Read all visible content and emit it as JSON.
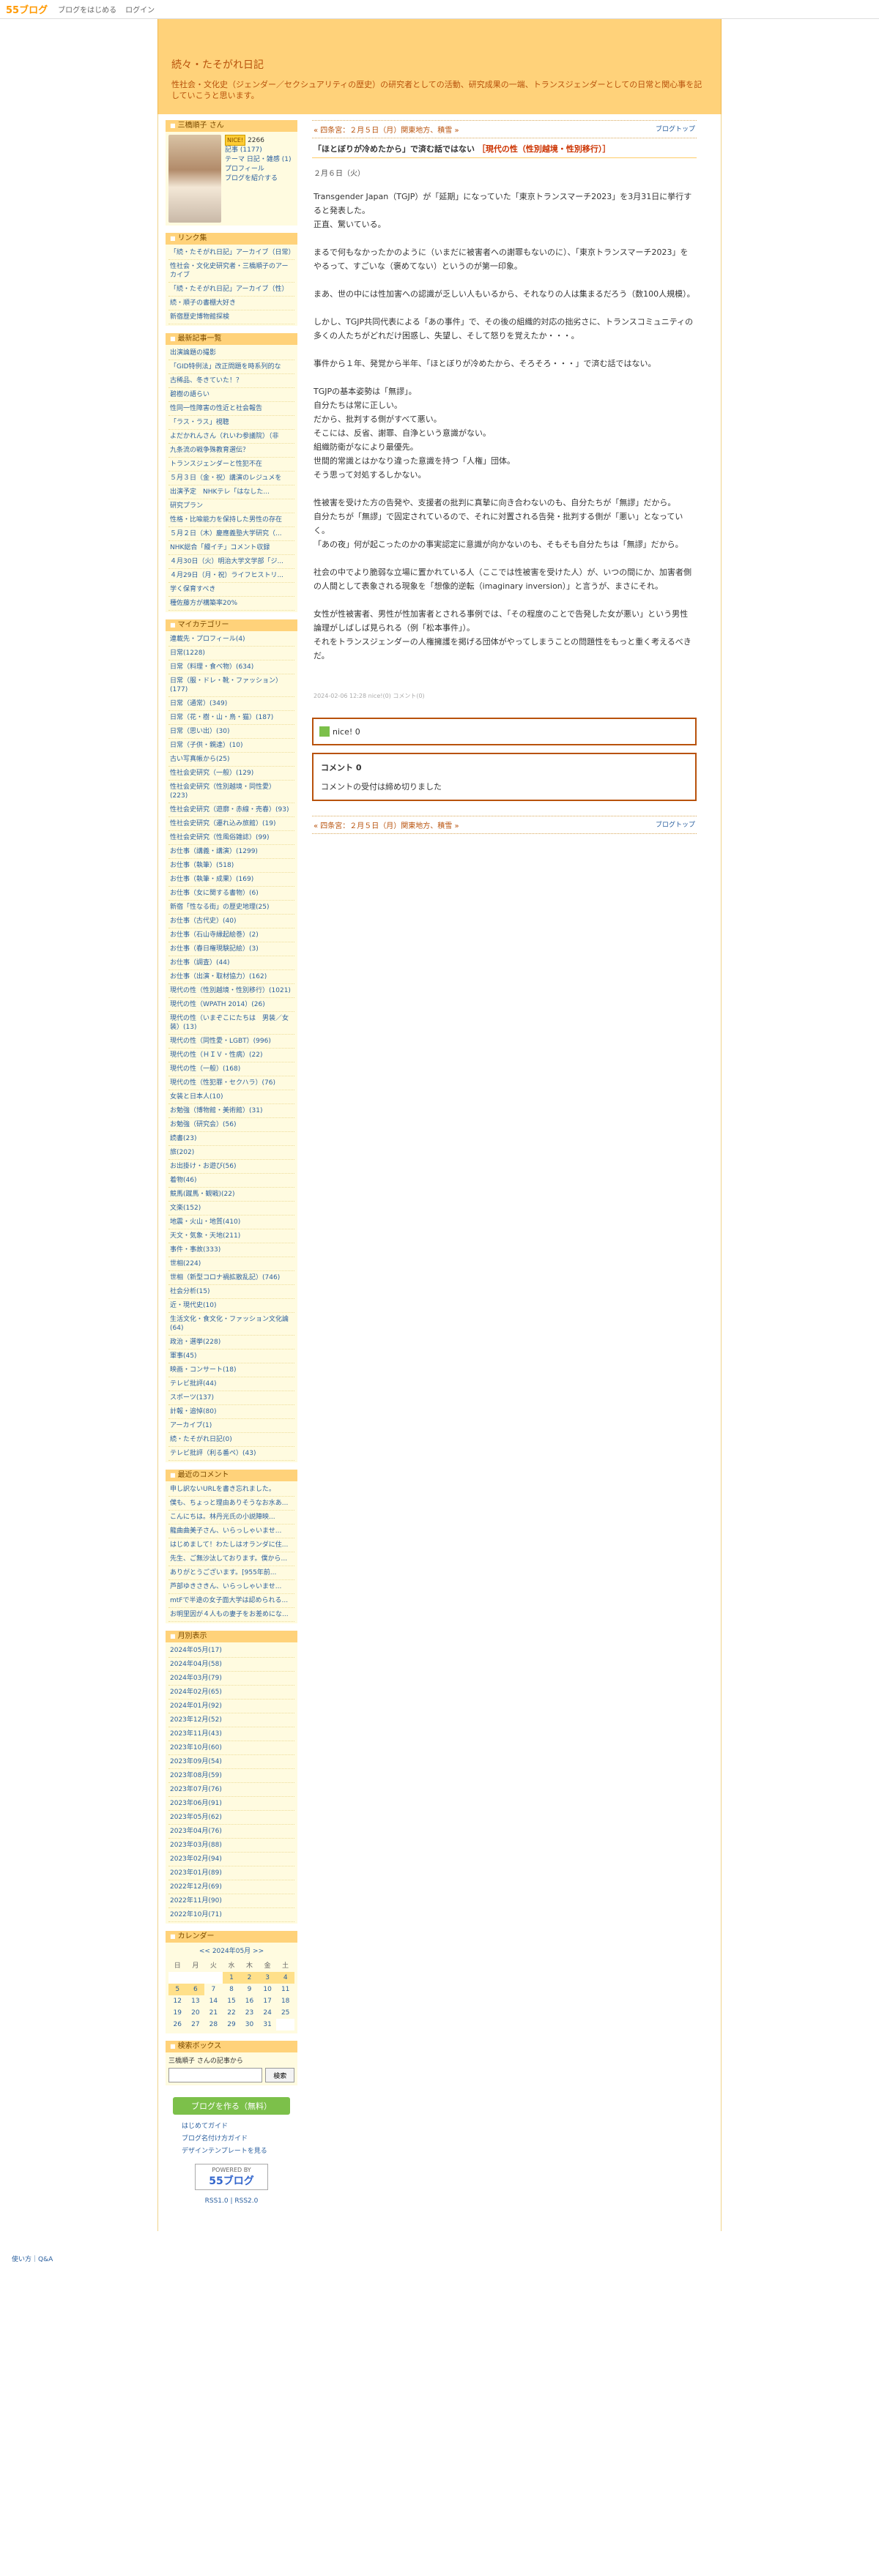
{
  "topbar": {
    "logo": "55ブログ",
    "links": [
      "ブログをはじめる",
      "ログイン"
    ]
  },
  "header": {
    "title": "続々・たそがれ日記",
    "description": "性社会・文化史（ジェンダー／セクシュアリティの歴史）の研究者としての活動、研究成果の一端、トランスジェンダーとしての日常と関心事を記していこうと思います。"
  },
  "profile": {
    "heading": "三橋順子 さん",
    "badge": "NICE!",
    "nice_count": "2266",
    "kiji": "記事 (1177)",
    "theme": "テーマ 日記・雑感 (1)",
    "links": [
      "プロフィール",
      "ブログを紹介する"
    ]
  },
  "links_widget": {
    "heading": "リンク集",
    "items": [
      "「続・たそがれ日記」アーカイブ（日常）",
      "性社会・文化史研究者・三橋順子のアーカイブ",
      "「続・たそがれ日記」アーカイブ（性）",
      "続・順子の書棚大好き",
      "新宿歴史博物館探検"
    ]
  },
  "recent_widget": {
    "heading": "最新記事一覧",
    "items": [
      "出演論題の撮影",
      "「GID特例法」改正問題を時系列的な",
      "古稀品、冬きていた！？",
      "碧樹の語らい",
      "性同一性障害の性近と社会報告",
      "「ラス・ラス」視聴",
      "よだかれんさん（れいわ参議院）（非",
      "九条流の戦争殊教育選伝？",
      "トランスジェンダーと性犯不在",
      "５月３日（金・祝）講演のレジュメを",
      "出演予定　NHKテレ「はなした...",
      "研究プラン",
      "性格・比喩能力を保持した男性の存在",
      "５月２日（木）慶應義塾大学研究（...",
      "NHK総合「饅イチ」コメント収録",
      "４月30日（火）明治大学文学部「ジ...",
      "４月29日（月・祝）ライフヒストリ...",
      "学く保育すべき",
      "種佐藤方が構築率20%"
    ]
  },
  "category_widget": {
    "heading": "マイカテゴリー",
    "items": [
      "連載先・プロフィール(4)",
      "日常(1228)",
      "日常（料理・食べ物）(634)",
      "日常（服・ドレ・靴・ファッション）(177)",
      "日常（通常）(349)",
      "日常（花・樹・山・鳥・猫）(187)",
      "日常（思い出）(30)",
      "日常（子供・親達）(10)",
      "古い写真帳から(25)",
      "性社会史研究（一般）(129)",
      "性社会史研究（性別越境・同性愛）(223)",
      "性社会史研究（遊廓・赤線・売春）(93)",
      "性社会史研究（遷れ込み旅館）(19)",
      "性社会史研究（性風俗雑誌）(99)",
      "お仕事（講義・講演）(1299)",
      "お仕事（執筆）(518)",
      "お仕事（執筆・成果）(169)",
      "お仕事（女に関する書物）(6)",
      "新宿「性なる街」の歴史地理(25)",
      "お仕事（古代史）(40)",
      "お仕事（石山寺縁起絵巻）(2)",
      "お仕事（春日権現験記絵）(3)",
      "お仕事（調査）(44)",
      "お仕事（出演・取材協力）(162)",
      "現代の性（性別越境・性別移行）(1021)",
      "現代の性（WPATH 2014）(26)",
      "現代の性（いまぞこにたちは　男装／女装）(13)",
      "現代の性（同性愛・LGBT）(996)",
      "現代の性（ＨＩＶ・性病）(22)",
      "現代の性（一般）(168)",
      "現代の性（性犯罪・セクハラ）(76)",
      "女装と日本人(10)",
      "お勉強（博物館・美術館）(31)",
      "お勉強（研究会）(56)",
      "読書(23)",
      "旅(202)",
      "お出掛け・お遊び(56)",
      "着物(46)",
      "競馬(蹴馬・観戦)(22)",
      "文楽(152)",
      "地震・火山・地質(410)",
      "天文・気象・天地(211)",
      "事件・事故(333)",
      "世相(224)",
      "世相（新型コロナ禍拡散乱記）(746)",
      "社会分析(15)",
      "近・現代史(10)",
      "生活文化・食文化・ファッション文化論(64)",
      "政治・選挙(228)",
      "軍事(45)",
      "映画・コンサート(18)",
      "テレビ批評(44)",
      "スポーツ(137)",
      "計報・追悼(80)",
      "アーカイブ(1)",
      "続・たそがれ日記(0)",
      "テレビ批評（利る番ペ）(43)"
    ]
  },
  "comments_widget": {
    "heading": "最近のコメント",
    "items": [
      "申し訳ないURLを書き忘れました。",
      "僕も、ちょっと理由ありそうなお水あ...",
      "こんにちは。林丹光氏の小説陣映...",
      "龍曲曲美子さん、いらっしゃいませ...",
      "はじめまして！わたしはオランダに住...",
      "先生、ご無沙汰しております。僕から...",
      "ありがとうございます。[955年前...",
      "芦部ゆきさきん、いらっしゃいませ...",
      "mtFで半途の女子面大学は認められる...",
      "お明里因が４人もの妻子をお差めにな..."
    ]
  },
  "archive_widget": {
    "heading": "月別表示",
    "items": [
      "2024年05月(17)",
      "2024年04月(58)",
      "2024年03月(79)",
      "2024年02月(65)",
      "2024年01月(92)",
      "2023年12月(52)",
      "2023年11月(43)",
      "2023年10月(60)",
      "2023年09月(54)",
      "2023年08月(59)",
      "2023年07月(76)",
      "2023年06月(91)",
      "2023年05月(62)",
      "2023年04月(76)",
      "2023年03月(88)",
      "2023年02月(94)",
      "2023年01月(89)",
      "2022年12月(69)",
      "2022年11月(90)",
      "2022年10月(71)"
    ]
  },
  "calendar": {
    "heading": "カレンダー",
    "nav": "<< 2024年05月 >>",
    "days": [
      "日",
      "月",
      "火",
      "水",
      "木",
      "金",
      "土"
    ],
    "rows": [
      [
        "",
        "",
        "",
        "1",
        "2",
        "3",
        "4"
      ],
      [
        "5",
        "6",
        "7",
        "8",
        "9",
        "10",
        "11"
      ],
      [
        "12",
        "13",
        "14",
        "15",
        "16",
        "17",
        "18"
      ],
      [
        "19",
        "20",
        "21",
        "22",
        "23",
        "24",
        "25"
      ],
      [
        "26",
        "27",
        "28",
        "29",
        "30",
        "31",
        ""
      ]
    ]
  },
  "search_widget": {
    "heading": "検索ボックス",
    "label": "三橋順子 さんの記事から",
    "button": "検索"
  },
  "make_blog": {
    "button": "ブログを作る（無料）",
    "links": [
      "はじめてガイド",
      "ブログ名付け方ガイド",
      "デザインテンプレートを見る"
    ],
    "powered_top": "POWERED BY",
    "powered_logo": "55ブログ",
    "rss": "RSS1.0 | RSS2.0"
  },
  "entry": {
    "prev": "« 四条宮：２月５日（月）関東地方、積雪 »",
    "top_link": "ブログトップ",
    "title": "「ほとぼりが冷めたから」で済む話ではない",
    "title_tag": "［現代の性（性別越境・性別移行）］",
    "date": "２月６日（火）",
    "paragraphs": [
      "Transgender Japan（TGJP）が「延期」になっていた「東京トランスマーチ2023」を3月31日に挙行すると発表した。\n正直、驚いている。",
      "まるで何もなかったかのように（いまだに被害者への謝罪もないのに）、「東京トランスマーチ2023」をやるって、すごいな（褒めてない）というのが第一印象。",
      "まあ、世の中には性加害への認識が乏しい人もいるから、それなりの人は集まるだろう（数100人規模）。",
      "しかし、TGJP共同代表による「あの事件」で、その後の組織的対応の拙劣さに、トランスコミュニティの多くの人たちがどれだけ困惑し、失望し、そして怒りを覚えたか・・・。",
      "事件から１年、発覚から半年、「ほとぼりが冷めたから、そろそろ・・・」で済む話ではない。",
      "TGJPの基本姿勢は「無謬」。\n自分たちは常に正しい。\nだから、批判する側がすべて悪い。\nそこには、反省、謝罪、自浄という意識がない。\n組織防衛がなにより最優先。\n世間的常識とはかなり違った意識を持つ「人権」団体。\nそう思って対処するしかない。",
      "性被害を受けた方の告発や、支援者の批判に真摯に向き合わないのも、自分たちが「無謬」だから。\n自分たちが「無謬」で固定されているので、それに対置される告発・批判する側が「悪い」となっていく。\n「あの夜」何が起こったのかの事実認定に意識が向かないのも、そもそも自分たちは「無謬」だから。",
      "社会の中でより脆弱な立場に置かれている人（ここでは性被害を受けた人）が、いつの間にか、加害者側の人間として表象される現象を「想像的逆転（imaginary inversion）」と言うが、まさにそれ。",
      "女性が性被害者、男性が性加害者とされる事例では、「その程度のことで告発した女が悪い」という男性論理がしばしば見られる（例「松本事件」）。\nそれをトランスジェンダーの人権擁護を掲げる団体がやってしまうことの問題性をもっと重く考えるべきだ。"
    ],
    "meta": "2024-02-06 12:28  nice!(0)  コメント(0)",
    "nice": "nice! 0",
    "comment_title": "コメント 0",
    "comment_closed": "コメントの受付は締め切りました",
    "foot_prev": "« 四条宮：２月５日（月）関東地方、積雪 »",
    "foot_top": "ブログトップ"
  },
  "footer": {
    "link": "使い方｜Q&A"
  }
}
